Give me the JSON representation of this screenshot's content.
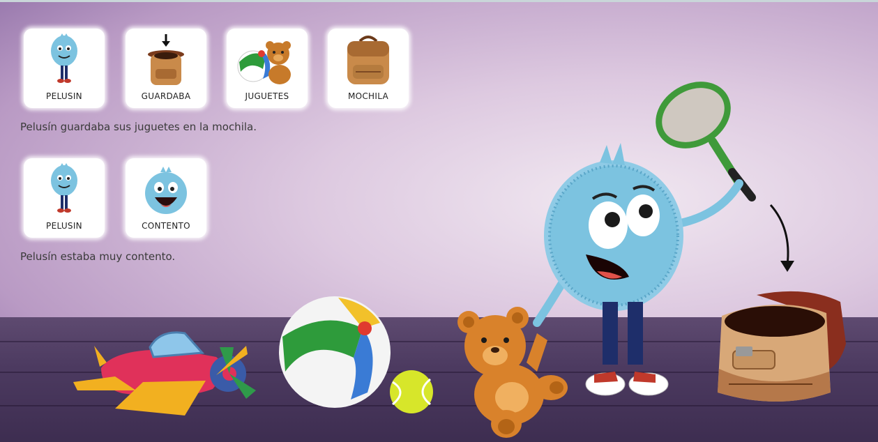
{
  "row1": {
    "cards": [
      {
        "label": "PELUSIN",
        "icon": "pelusin-standing-icon"
      },
      {
        "label": "GUARDABA",
        "icon": "open-backpack-arrow-icon"
      },
      {
        "label": "JUGUETES",
        "icon": "ball-and-teddy-icon"
      },
      {
        "label": "MOCHILA",
        "icon": "backpack-icon"
      }
    ],
    "sentence": "Pelusín guardaba sus juguetes en la mochila."
  },
  "row2": {
    "cards": [
      {
        "label": "PELUSIN",
        "icon": "pelusin-standing-icon"
      },
      {
        "label": "CONTENTO",
        "icon": "happy-face-icon"
      }
    ],
    "sentence": "Pelusín estaba muy contento."
  },
  "colors": {
    "pelusin_blue": "#7cc3e0",
    "backpack_brown": "#c98a4a",
    "floor": "#4c3a60"
  }
}
